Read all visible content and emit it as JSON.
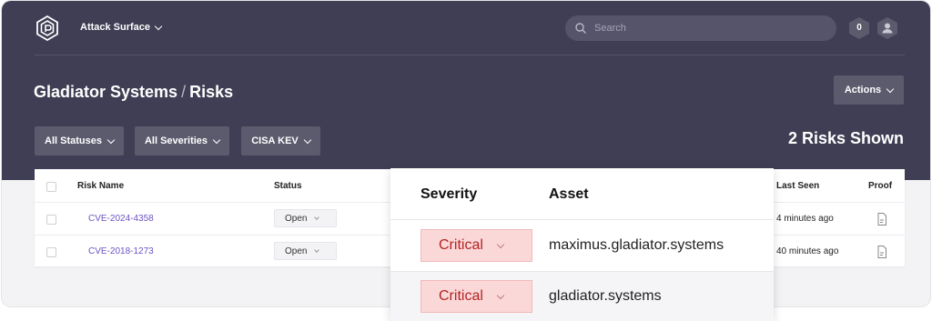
{
  "header": {
    "app_name": "Attack Surface",
    "search_placeholder": "Search",
    "notification_count": "0"
  },
  "page": {
    "org": "Gladiator Systems",
    "separator": "/",
    "section": "Risks",
    "actions_label": "Actions",
    "risks_shown": "2 Risks Shown"
  },
  "filters": {
    "statuses": "All Statuses",
    "severities": "All Severities",
    "cisa": "CISA KEV"
  },
  "table": {
    "columns": {
      "risk_name": "Risk Name",
      "status": "Status",
      "severity": "Severity",
      "asset": "Asset",
      "last_seen": "Last Seen",
      "proof": "Proof"
    },
    "rows": [
      {
        "name": "CVE-2024-4358",
        "status": "Open",
        "severity": "Critical",
        "asset": "maximus.gladiator.systems",
        "last_seen": "4 minutes ago"
      },
      {
        "name": "CVE-2018-1273",
        "status": "Open",
        "severity": "Critical",
        "asset": "gladiator.systems",
        "last_seen": "40 minutes ago"
      }
    ]
  },
  "colors": {
    "header_bg": "#3f3e54",
    "link": "#6b52c4",
    "critical_bg": "#fbd8d8",
    "critical_text": "#b42323"
  },
  "icons": [
    "logo-icon",
    "chevron-down-icon",
    "search-icon",
    "notification-icon",
    "user-icon",
    "checkbox-icon",
    "file-icon"
  ]
}
